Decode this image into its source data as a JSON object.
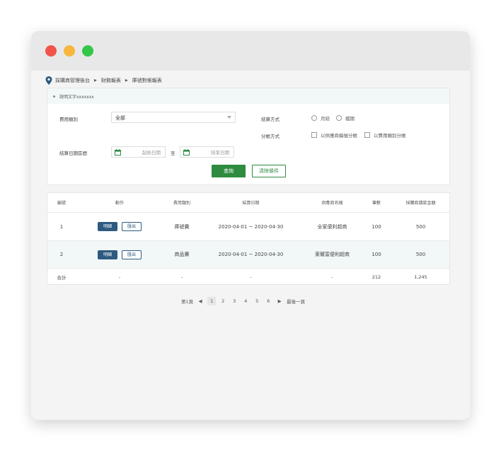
{
  "breadcrumb": {
    "items": [
      "採購商管理後台",
      "財務報表",
      "庫號對帳報表"
    ]
  },
  "description": {
    "text": "說明文字xxxxxxx"
  },
  "filters": {
    "fee_category_label": "費用類別",
    "fee_category_value": "全部",
    "settlement_method_label": "結算方式",
    "settlement_options": [
      "月結",
      "檔期"
    ],
    "split_method_label": "分帳方式",
    "split_options": [
      "以供應商編號分帳",
      "以費用類別分帳"
    ],
    "date_range_label": "結算日期區間",
    "start_date_placeholder": "起始日期",
    "to_label": "至",
    "end_date_placeholder": "結束日期",
    "search_button": "查詢",
    "clear_button": "清除條件"
  },
  "table": {
    "headers": [
      "編號",
      "動作",
      "費用類別",
      "結算日期",
      "供應商名稱",
      "筆數",
      "採購商請款金額"
    ],
    "action_detail": "明細",
    "action_export": "匯出",
    "rows": [
      {
        "no": "1",
        "category": "庫號費",
        "date": "2020-04-01 ~ 2020-04-30",
        "supplier": "全家便利超商",
        "count": "100",
        "amount": "500"
      },
      {
        "no": "2",
        "category": "商品費",
        "date": "2020-04-01 ~ 2020-04-30",
        "supplier": "萊爾富便利超商",
        "count": "100",
        "amount": "500"
      }
    ],
    "summary": {
      "label": "合計",
      "action": "-",
      "category": "-",
      "date": "-",
      "supplier": "-",
      "count": "212",
      "amount": "1,245"
    }
  },
  "pagination": {
    "first": "第1頁",
    "pages": [
      "1",
      "2",
      "3",
      "4",
      "5",
      "6"
    ],
    "current": "1",
    "last": "最後一頁"
  },
  "colors": {
    "primary_green": "#2e8b3f",
    "primary_blue": "#2d5a80",
    "window_close": "#f2544b",
    "window_minimize": "#f6b73c",
    "window_zoom": "#33c748"
  },
  "icons": [
    "location-pin-icon",
    "calendar-icon",
    "chevron-right-icon",
    "caret-down-icon",
    "caret-left-icon",
    "caret-right-icon"
  ]
}
